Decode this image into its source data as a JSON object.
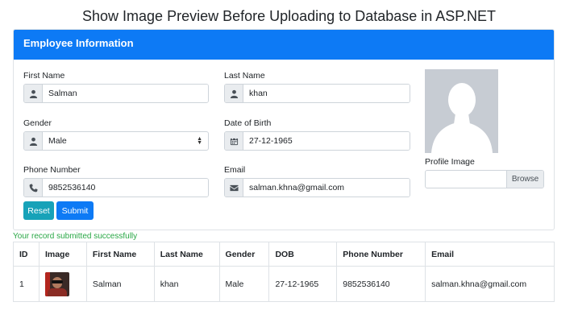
{
  "page": {
    "title": "Show Image Preview Before Uploading to Database in ASP.NET"
  },
  "card": {
    "header": "Employee Information"
  },
  "form": {
    "first_name": {
      "label": "First Name",
      "value": "Salman"
    },
    "last_name": {
      "label": "Last Name",
      "value": "khan"
    },
    "gender": {
      "label": "Gender",
      "value": "Male"
    },
    "dob": {
      "label": "Date of Birth",
      "value": "27-12-1965"
    },
    "phone": {
      "label": "Phone Number",
      "value": "9852536140"
    },
    "email": {
      "label": "Email",
      "value": "salman.khna@gmail.com"
    },
    "profile_image": {
      "label": "Profile Image",
      "browse_label": "Browse"
    },
    "reset_label": "Reset",
    "submit_label": "Submit"
  },
  "status": {
    "message": "Your record submitted successfully"
  },
  "table": {
    "headers": [
      "ID",
      "Image",
      "First Name",
      "Last Name",
      "Gender",
      "DOB",
      "Phone Number",
      "Email"
    ],
    "rows": [
      {
        "id": "1",
        "first_name": "Salman",
        "last_name": "khan",
        "gender": "Male",
        "dob": "27-12-1965",
        "phone": "9852536140",
        "email": "salman.khna@gmail.com"
      }
    ]
  },
  "icons": {
    "first_name": "user-icon",
    "last_name": "user-icon",
    "gender": "user-icon",
    "dob": "calendar-icon",
    "phone": "phone-icon",
    "email": "envelope-icon"
  },
  "colors": {
    "header_bg": "#0d7af5",
    "reset_bg": "#17a2b8",
    "submit_bg": "#0d7af5",
    "success_text": "#28a745"
  }
}
